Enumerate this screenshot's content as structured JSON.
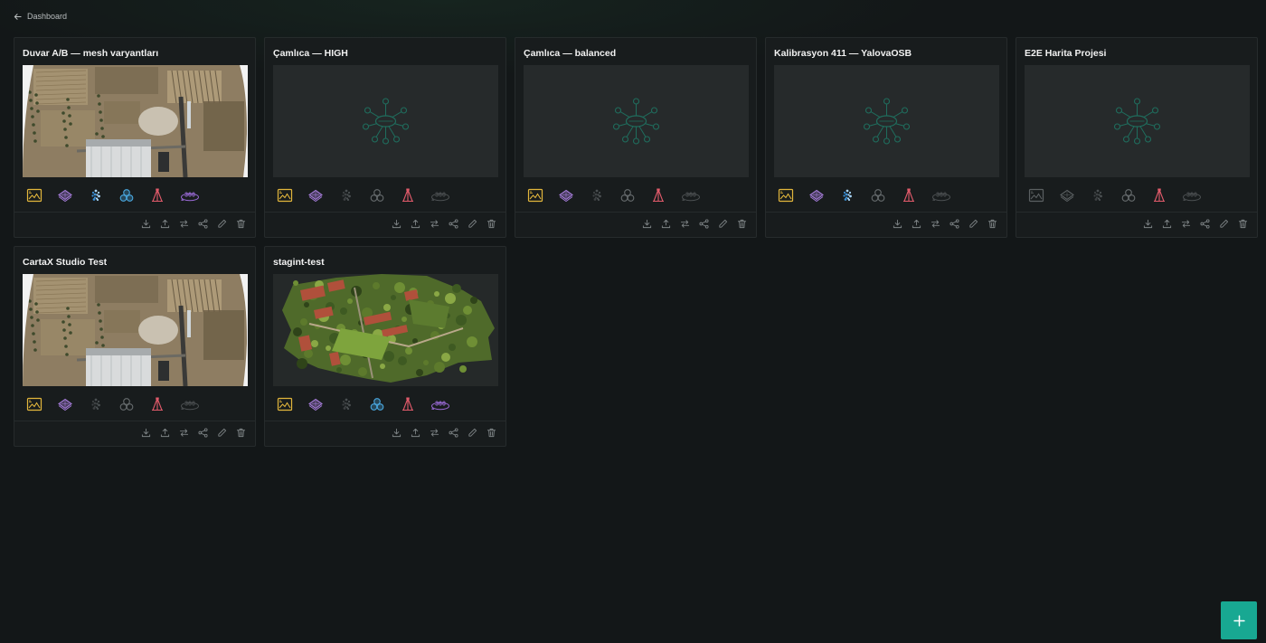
{
  "nav": {
    "back_label": "Dashboard"
  },
  "colors": {
    "accent": "#18a892",
    "ortho": "#e2b63c",
    "layers": "#a47bd8",
    "pointcloud": "#3b8fd4",
    "mesh": "#4aa8e0",
    "survey": "#e05a6a",
    "pano": "#9a6ad6",
    "disabled": "#5b6062",
    "placeholder": "#1f6d5d"
  },
  "projects": [
    {
      "title": "Duvar A/B — mesh varyantları",
      "thumbnail": "aerial-factory",
      "features": {
        "orthophoto": true,
        "elevation": true,
        "pointcloud": true,
        "mesh": true,
        "survey": true,
        "panorama": true
      }
    },
    {
      "title": "Çamlıca — HIGH",
      "thumbnail": "placeholder",
      "features": {
        "orthophoto": true,
        "elevation": true,
        "pointcloud": false,
        "mesh": false,
        "survey": true,
        "panorama": false
      }
    },
    {
      "title": "Çamlıca — balanced",
      "thumbnail": "placeholder",
      "features": {
        "orthophoto": true,
        "elevation": true,
        "pointcloud": false,
        "mesh": false,
        "survey": true,
        "panorama": false
      }
    },
    {
      "title": "Kalibrasyon 411 — YalovaOSB",
      "thumbnail": "placeholder",
      "features": {
        "orthophoto": true,
        "elevation": true,
        "pointcloud": true,
        "mesh": false,
        "survey": true,
        "panorama": false
      }
    },
    {
      "title": "E2E Harita Projesi",
      "thumbnail": "placeholder",
      "features": {
        "orthophoto": false,
        "elevation": false,
        "pointcloud": false,
        "mesh": false,
        "survey": true,
        "panorama": false
      }
    },
    {
      "title": "CartaX Studio Test",
      "thumbnail": "aerial-factory",
      "features": {
        "orthophoto": true,
        "elevation": true,
        "pointcloud": false,
        "mesh": false,
        "survey": true,
        "panorama": false
      }
    },
    {
      "title": "stagint-test",
      "thumbnail": "aerial-village",
      "features": {
        "orthophoto": true,
        "elevation": true,
        "pointcloud": false,
        "mesh": true,
        "survey": true,
        "panorama": true
      }
    }
  ],
  "feature_icons": [
    "orthophoto-icon",
    "elevation-layers-icon",
    "pointcloud-icon",
    "mesh-icon",
    "survey-icon",
    "panorama-360-icon"
  ],
  "panorama_label": "360",
  "card_actions": [
    "download-icon",
    "upload-icon",
    "transfer-icon",
    "share-icon",
    "edit-icon",
    "delete-icon"
  ],
  "fab_icon": "plus-icon"
}
